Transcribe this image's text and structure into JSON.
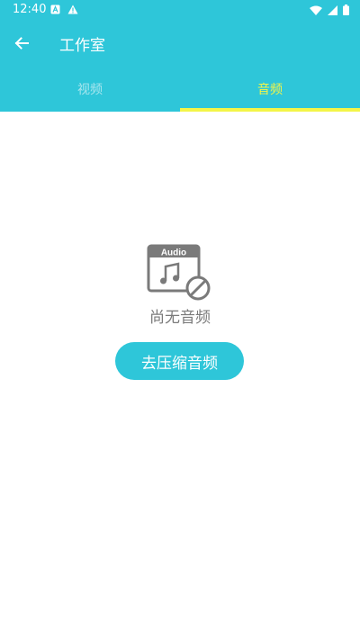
{
  "status_bar": {
    "time": "12:40",
    "left_icons": [
      "a-badge-icon",
      "warning-icon"
    ],
    "right_icons": [
      "wifi-icon",
      "signal-icon",
      "battery-icon"
    ]
  },
  "toolbar": {
    "back_icon": "arrow-left-icon",
    "title": "工作室"
  },
  "tabs": [
    {
      "label": "视频",
      "selected": false
    },
    {
      "label": "音频",
      "selected": true
    }
  ],
  "empty_state": {
    "icon": "audio-file-disabled-icon",
    "icon_label": "Audio",
    "message": "尚无音频"
  },
  "action_button": {
    "label": "去压缩音频"
  },
  "colors": {
    "primary": "#2ec6d9",
    "tab_selected": "#f3f548",
    "tab_unselected": "#a9e6ee",
    "empty_text": "#7a7a7a"
  }
}
